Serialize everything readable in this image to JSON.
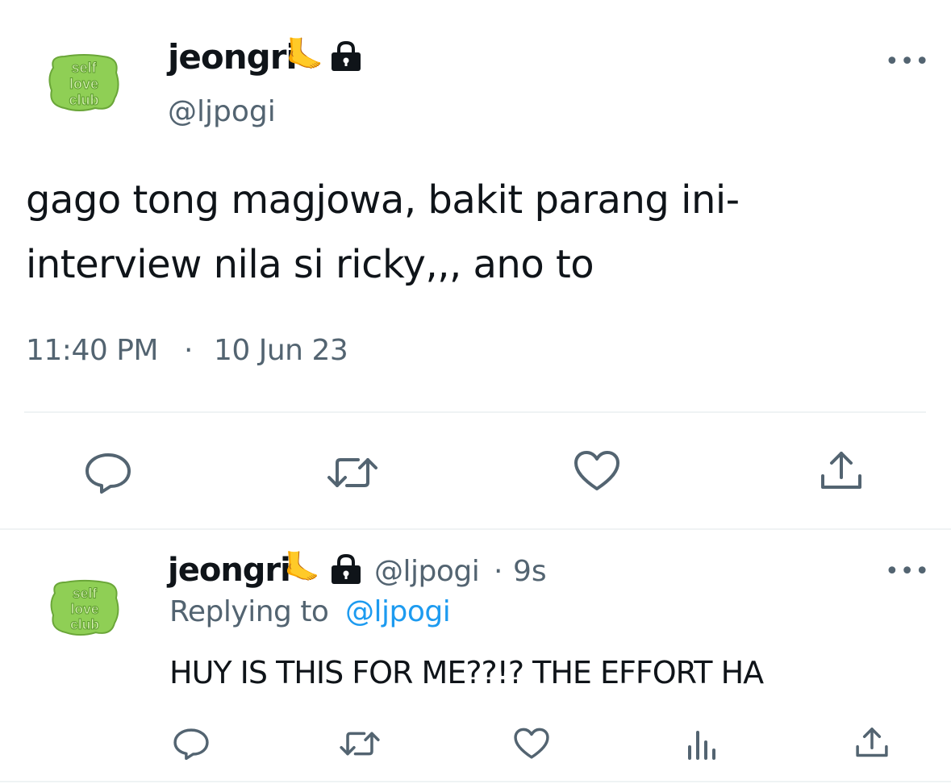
{
  "main_tweet": {
    "author_name": "jeongri",
    "name_emoji": "🦶",
    "handle": "@ljpogi",
    "avatar_text": [
      "self",
      "love",
      "club"
    ],
    "text_line1": "gago tong magjowa, bakit parang ini-",
    "text_line2": "interview nila si ricky,,, ano to",
    "time": "11:40 PM",
    "separator": "·",
    "date": "10 Jun 23"
  },
  "reply": {
    "author_name": "jeongri",
    "name_emoji": "🦶",
    "handle": "@ljpogi",
    "meta_sep": "·",
    "age": "9s",
    "avatar_text": [
      "self",
      "love",
      "club"
    ],
    "replying_label": "Replying to",
    "replying_handle": "@ljpogi",
    "text": "HUY IS THIS FOR ME??!? THE EFFORT HA"
  },
  "more_glyph": "•••",
  "icons": {
    "reply": "reply-icon",
    "retweet": "retweet-icon",
    "like": "heart-icon",
    "share": "share-icon",
    "views": "views-icon",
    "lock": "lock-icon"
  },
  "colors": {
    "text": "#0f1419",
    "muted": "#536471",
    "link": "#1d9bf0",
    "avatar_green": "#8fcf55"
  }
}
